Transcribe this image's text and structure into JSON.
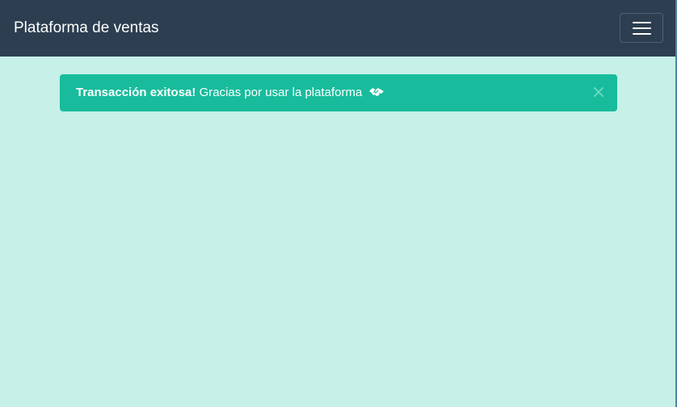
{
  "navbar": {
    "brand": "Plataforma de ventas",
    "toggle_icon": "hamburger-menu-icon"
  },
  "alert": {
    "title": "Transacción exitosa!",
    "message": "Gracias por usar la plataforma",
    "icon": "handshake-icon",
    "close_label": "×"
  },
  "colors": {
    "navbar_bg": "#2c3e50",
    "page_bg": "#c6f0e8",
    "alert_bg": "#18bc9c",
    "alert_close": "#6fd8c3"
  }
}
